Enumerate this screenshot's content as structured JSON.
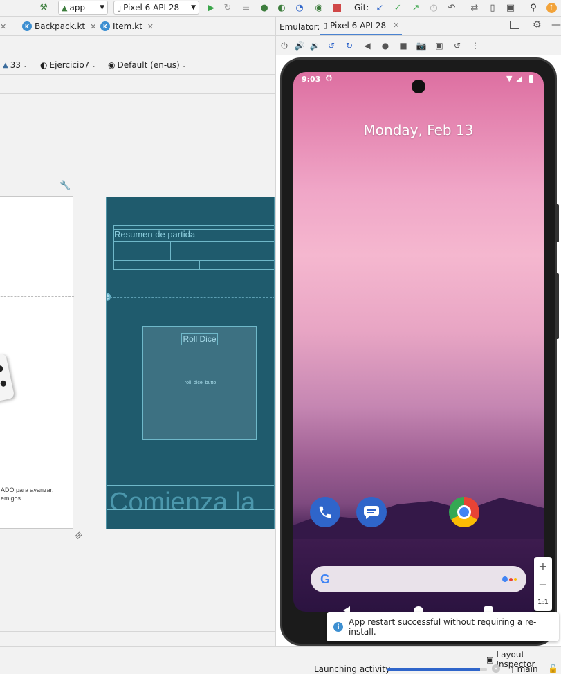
{
  "toolbar": {
    "run_config": "app",
    "device": "Pixel 6 API 28",
    "git_label": "Git:"
  },
  "editor_tabs": [
    {
      "label": "Backpack.kt"
    },
    {
      "label": "Item.kt"
    }
  ],
  "design_bar": {
    "api": "33",
    "theme": "Ejercicio7",
    "locale": "Default (en-us)"
  },
  "design_canvas": {
    "white_text_line1": "ADO para avanzar.",
    "white_text_line2": "emigos.",
    "blueprint_header": "Resumen de partida",
    "blueprint_button": "Roll Dice",
    "blueprint_button_id": "roll_dice_butto",
    "blueprint_footer": "Comienza la"
  },
  "emulator": {
    "label": "Emulator:",
    "device_tab": "Pixel 6 API 28",
    "time": "9:03",
    "date": "Monday, Feb 13",
    "zoom_ratio": "1:1"
  },
  "toast": {
    "message": "App restart successful without requiring a re-install."
  },
  "status": {
    "layout_inspector": "Layout Inspector",
    "activity": "Launching activity",
    "progress": 0.93,
    "branch": "main"
  },
  "colors": {
    "blueprint_bg": "#1f5b6d",
    "accent": "#2f65ca"
  }
}
